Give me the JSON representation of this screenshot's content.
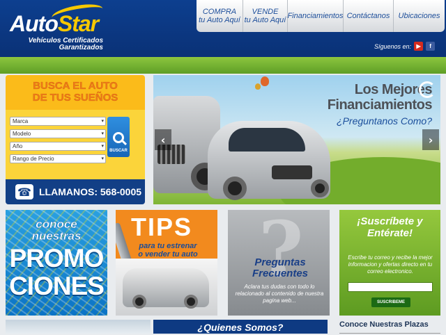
{
  "logo": {
    "name_part1": "Auto",
    "name_part2": "Star",
    "tagline_line1": "Vehículos Certificados",
    "tagline_line2": "Garantizados"
  },
  "nav": [
    {
      "line1": "COMPRA",
      "line2": "tu Auto Aquí"
    },
    {
      "line1": "VENDE",
      "line2": "tu Auto Aquí"
    },
    {
      "line1": "Financiamientos",
      "line2": ""
    },
    {
      "line1": "Contáctanos",
      "line2": ""
    },
    {
      "line1": "Ubicaciones",
      "line2": ""
    }
  ],
  "follow": {
    "label": "Síguenos en:",
    "icons": [
      "youtube-icon",
      "facebook-icon"
    ]
  },
  "search": {
    "title_line1": "BUSCA EL AUTO",
    "title_line2": "DE TUS SUEÑOS",
    "selects": [
      "Marca",
      "Modelo",
      "Año",
      "Rango de Precio"
    ],
    "button_label": "BUSCAR",
    "phone_label": "LLAMANOS: 568-0005"
  },
  "hero": {
    "title_line1": "Los Mejores",
    "title_line2": "Financiamientos",
    "subtitle": "¿Preguntanos Como?",
    "prev": "‹",
    "next": "›"
  },
  "tiles": {
    "promociones": {
      "line1": "conoce",
      "line2": "nuestras",
      "big1": "PROMO",
      "big2": "CIONES"
    },
    "tips": {
      "title": "TIPS",
      "line1": "para tu estrenar",
      "line2": "o vender tu auto"
    },
    "preguntas": {
      "title_line1": "Preguntas",
      "title_line2": "Frecuentes",
      "body": "Aclara tus dudas con todo lo relacionado al contenido de nuestra pagina web..."
    },
    "suscribete": {
      "title_line1": "¡Suscríbete y",
      "title_line2": "Entérate!",
      "body": "Escribe tu correo y recibe la mejor informacion y ofertas directo en tu correo electronico.",
      "button": "SUSCRIBEME"
    }
  },
  "bottom": {
    "quienes": "¿Quienes Somos?",
    "plazas": "Conoce Nuestras Plazas"
  },
  "colors": {
    "header_blue": "#0d3f8f",
    "green": "#8dc63f",
    "orange": "#f28a1e",
    "yellow": "#fbbb1a"
  }
}
